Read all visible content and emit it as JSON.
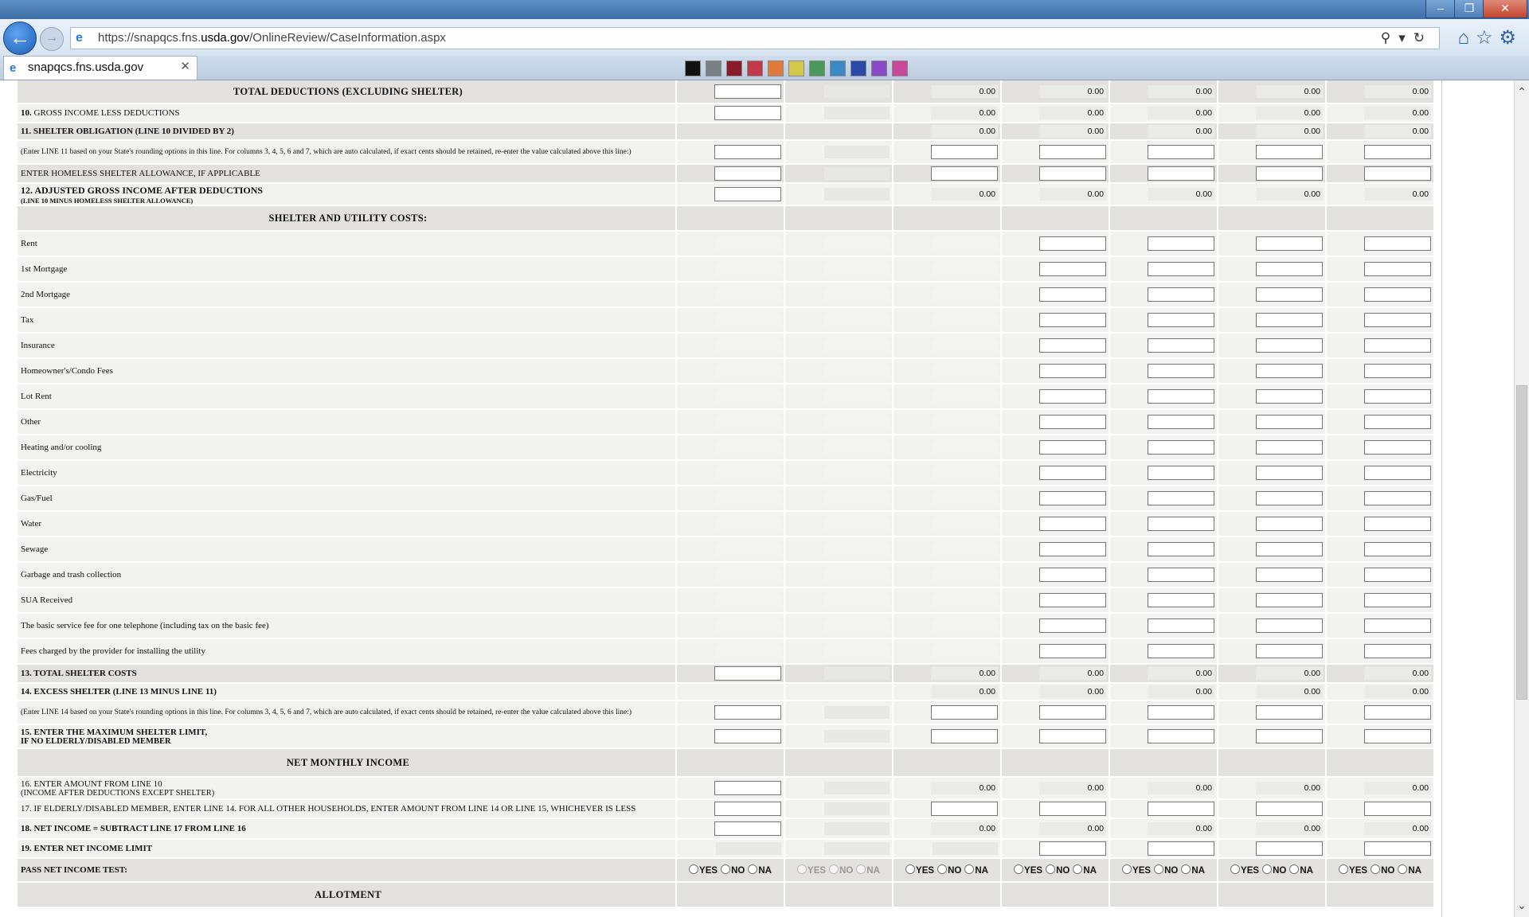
{
  "browser": {
    "url_prefix": "https://snapqcs.fns.",
    "url_domain": "usda.gov",
    "url_path": "/OnlineReview/CaseInformation.aspx",
    "tab_title": "snapqcs.fns.usda.gov",
    "window_buttons": [
      "–",
      "❐",
      "✕"
    ]
  },
  "labels": {
    "total_deductions": "TOTAL DEDUCTIONS (EXCLUDING SHELTER)",
    "line10_num": "10.",
    "line10": "GROSS INCOME LESS DEDUCTIONS",
    "line11": "11. SHELTER OBLIGATION (LINE 10 DIVIDED BY 2)",
    "line11_note": "(Enter LINE 11 based on your State's rounding options in this line. For columns 3, 4, 5, 6 and 7, which are auto calculated, if exact cents should be retained, re-enter the value calculated above this line:)",
    "homeless": "ENTER HOMELESS SHELTER ALLOWANCE, IF APPLICABLE",
    "line12": "12. ADJUSTED GROSS INCOME AFTER DEDUCTIONS",
    "line12_sub": "(LINE 10 MINUS HOMELESS SHELTER ALLOWANCE)",
    "shelter_header": "SHELTER AND UTILITY COSTS:",
    "costs": [
      "Rent",
      "1st Mortgage",
      "2nd Mortgage",
      "Tax",
      "Insurance",
      "Homeowner's/Condo Fees",
      "Lot Rent",
      "Other",
      "Heating and/or cooling",
      "Electricity",
      "Gas/Fuel",
      "Water",
      "Sewage",
      "Garbage and trash collection",
      "SUA Received",
      "The basic service fee for one telephone (including tax on the basic fee)",
      "Fees charged by the provider for installing the utility"
    ],
    "line13": "13. TOTAL SHELTER COSTS",
    "line14": "14. EXCESS SHELTER (LINE 13 MINUS LINE 11)",
    "line14_note": "(Enter LINE 14 based on your State's rounding options in this line. For columns 3, 4, 5, 6 and 7, which are auto calculated, if exact cents should be retained, re-enter the value calculated above this line:)",
    "line15a": "15. ENTER THE MAXIMUM SHELTER LIMIT,",
    "line15b": "IF NO ELDERLY/DISABLED MEMBER",
    "net_header": "NET MONTHLY INCOME",
    "line16a": "16. ENTER AMOUNT FROM LINE 10",
    "line16b": "(INCOME AFTER DEDUCTIONS EXCEPT SHELTER)",
    "line17": "17. IF ELDERLY/DISABLED MEMBER, ENTER LINE 14. FOR ALL OTHER HOUSEHOLDS, ENTER AMOUNT FROM LINE 14 OR LINE 15, WHICHEVER IS LESS",
    "line18": "18. NET INCOME = SUBTRACT LINE 17 FROM LINE 16",
    "line19": "19. ENTER NET INCOME LIMIT",
    "pass_test": "PASS NET INCOME TEST:",
    "allotment": "ALLOTMENT"
  },
  "radio_labels": {
    "yes": "YES",
    "no": "NO",
    "na": "NA"
  },
  "calc": {
    "total_deductions": [
      "0.00",
      "0.00",
      "0.00",
      "0.00",
      "0.00"
    ],
    "line10": [
      "0.00",
      "0.00",
      "0.00",
      "0.00",
      "0.00"
    ],
    "line11": [
      "0.00",
      "0.00",
      "0.00",
      "0.00",
      "0.00"
    ],
    "line12": [
      "0.00",
      "0.00",
      "0.00",
      "0.00",
      "0.00"
    ],
    "line13": [
      "0.00",
      "0.00",
      "0.00",
      "0.00",
      "0.00"
    ],
    "line14": [
      "0.00",
      "0.00",
      "0.00",
      "0.00",
      "0.00"
    ],
    "line16": [
      "0.00",
      "0.00",
      "0.00",
      "0.00",
      "0.00"
    ],
    "line18": [
      "0.00",
      "0.00",
      "0.00",
      "0.00",
      "0.00"
    ]
  },
  "colors": {
    "row_dark": "#e2e1dd",
    "row_light": "#f2f2f1",
    "browser_blue": "#3e6fa8"
  }
}
